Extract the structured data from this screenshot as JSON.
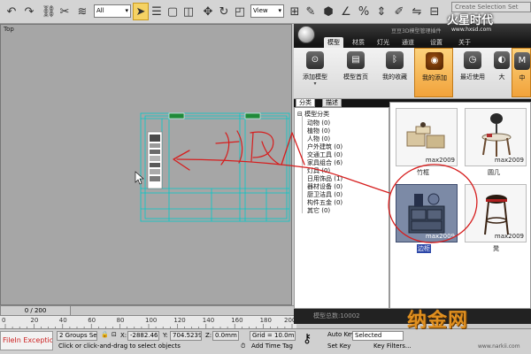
{
  "toolbar": {
    "filter_select": "All",
    "view_select": "View",
    "selection_set": "Create Selection Set"
  },
  "viewport": {
    "label": "Top",
    "frame_counter": "0 / 200"
  },
  "ruler": {
    "ticks": [
      "0",
      "20",
      "40",
      "60",
      "80",
      "100",
      "120",
      "140",
      "160",
      "180",
      "200"
    ]
  },
  "status": {
    "exception": "FileIn Exception",
    "groups_selected": "2 Groups Sel",
    "x_label": "X:",
    "x_value": "-2882.468",
    "y_label": "Y:",
    "y_value": "704.5239",
    "z_label": "Z:",
    "z_value": "0.0mm",
    "grid": "Grid = 10.0mm",
    "prompt": "Click or click-and-drag to select objects",
    "add_time_tag": "Add Time Tag",
    "auto_key": "Auto Key",
    "auto_key_value": "Selected",
    "set_key": "Set Key",
    "key_filters": "Key Filters..."
  },
  "panel": {
    "title": "豆豆3D模型管理插件",
    "tabs": [
      "模型",
      "材质",
      "灯光",
      "通道",
      "设置",
      "关于"
    ],
    "ribbon_buttons": [
      {
        "label": "添加模型",
        "sub": "▾",
        "icon": "rss-icon"
      },
      {
        "label": "模型首页",
        "sub": "",
        "icon": "book-icon"
      },
      {
        "label": "我的收藏",
        "sub": "",
        "icon": "bluetooth-icon"
      },
      {
        "label": "我的添加",
        "sub": "",
        "icon": "folder-icon"
      },
      {
        "label": "最近使用",
        "sub": "",
        "icon": "clock-icon"
      },
      {
        "label": "大",
        "sub": "",
        "icon": "size-large-icon"
      },
      {
        "label": "中",
        "sub": "",
        "icon": "size-medium-icon"
      }
    ],
    "category_tabs": [
      "分类",
      "描述"
    ],
    "tree": {
      "root": "模型分类",
      "items": [
        "动物 (0)",
        "植物 (0)",
        "人物 (0)",
        "户外建筑 (0)",
        "交通工具 (0)",
        "家具组合 (6)",
        "灯具 (0)",
        "日用饰品 (1)",
        "器材设备 (0)",
        "厨卫洁具 (0)",
        "构件五金 (0)",
        "其它 (0)"
      ]
    },
    "thumbnails": [
      {
        "tag": "max2009",
        "caption": "竹框",
        "selected": false
      },
      {
        "tag": "max2009",
        "caption": "圆几",
        "selected": false
      },
      {
        "tag": "max2009",
        "caption": "边柜",
        "selected": true
      },
      {
        "tag": "max2009",
        "caption": "凳",
        "selected": false
      }
    ],
    "footer": "模型总数:10002"
  },
  "watermarks": {
    "top": "火星时代",
    "top_url": "www.hxsd.com",
    "bottom": "纳金网",
    "bottom_url": "www.narkii.com"
  },
  "annotation": {
    "handwritten_text": "拖入",
    "color": "#d61e1e"
  },
  "colors": {
    "plan_lines": "#00c8c8",
    "viewport_bg": "#a6a6a6",
    "accent_orange": "#f1a23a",
    "selection_blue": "#2c47a8"
  }
}
